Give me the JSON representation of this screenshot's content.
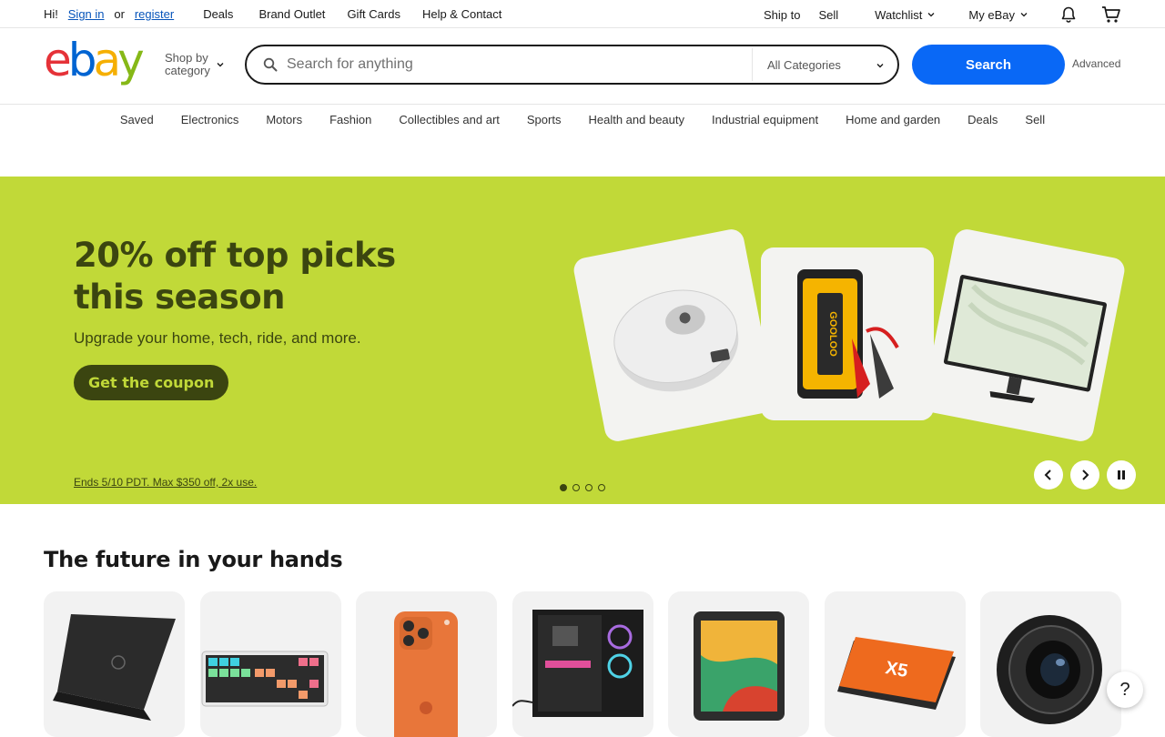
{
  "topbar": {
    "greeting_hi": "Hi!",
    "sign_in": "Sign in",
    "or": "or",
    "register": "register",
    "links": [
      "Deals",
      "Brand Outlet",
      "Gift Cards",
      "Help & Contact"
    ],
    "ship_to": "Ship to",
    "sell": "Sell",
    "watchlist": "Watchlist",
    "my_ebay": "My eBay"
  },
  "header": {
    "logo": {
      "e": "e",
      "b": "b",
      "a": "a",
      "y": "y"
    },
    "logo_colors": {
      "e": "#e53238",
      "b": "#0064d2",
      "a": "#f5af02",
      "y": "#86b817"
    },
    "shop_by_category": [
      "Shop by",
      "category"
    ],
    "search_placeholder": "Search for anything",
    "category_select": "All Categories",
    "search_button": "Search",
    "advanced": "Advanced"
  },
  "nav": [
    "Saved",
    "Electronics",
    "Motors",
    "Fashion",
    "Collectibles and art",
    "Sports",
    "Health and beauty",
    "Industrial equipment",
    "Home and garden",
    "Deals",
    "Sell"
  ],
  "hero": {
    "title": "20% off top picks this season",
    "subtitle": "Upgrade your home, tech, ride, and more.",
    "cta": "Get the coupon",
    "terms": "Ends 5/10 PDT. Max $350 off, 2x use.",
    "slide_count": 4,
    "active_slide": 1,
    "bg_color": "#c1d938",
    "text_color": "#3b4510"
  },
  "section": {
    "title": "The future in your hands",
    "tiles": [
      "laptop-image",
      "keyboard-image",
      "phone-image",
      "pc-tower-image",
      "tablet-image",
      "ssd-image",
      "camera-lens-image"
    ]
  },
  "help": "?"
}
